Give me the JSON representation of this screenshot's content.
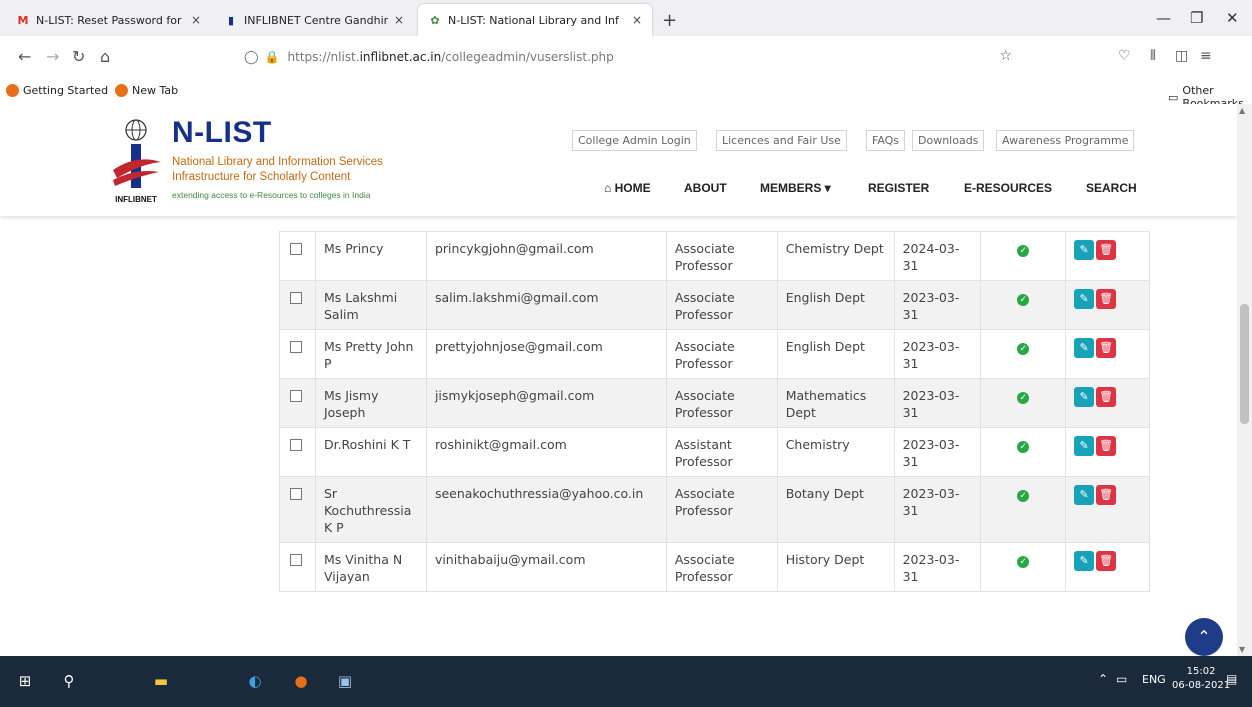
{
  "browser": {
    "tabs": [
      {
        "title": "N-LIST: Reset Password for Sr. M",
        "icon": "gmail-icon"
      },
      {
        "title": "INFLIBNET Centre Gandhinagar",
        "icon": "inflibnet-icon"
      },
      {
        "title": "N-LIST: National Library and Inf",
        "icon": "nlist-icon",
        "active": true
      }
    ],
    "url_prefix": "https://nlist.",
    "url_domain": "inflibnet.ac.in",
    "url_suffix": "/collegeadmin/vuserslist.php",
    "bookmarks": [
      "Getting Started",
      "New Tab"
    ],
    "other_bookmarks": "Other Bookmarks"
  },
  "site": {
    "logo_text": "INFLIBNET",
    "brand": "N-LIST",
    "line1": "National Library and Information Services",
    "line2": "Infrastructure for Scholarly Content",
    "tagline": "extending access to e-Resources to colleges in India",
    "top_links": [
      "College Admin Login",
      "Licences and Fair Use",
      "FAQs",
      "Downloads",
      "Awareness Programme"
    ],
    "nav": {
      "home": "HOME",
      "about": "ABOUT",
      "members": "MEMBERS",
      "register": "REGISTER",
      "eresources": "E-RESOURCES",
      "search": "SEARCH"
    }
  },
  "users": [
    {
      "name": "Ms Princy",
      "email": "princykgjohn@gmail.com",
      "designation": "Associate Professor",
      "department": "Chemistry Dept",
      "expiry": "2024-03-31"
    },
    {
      "name": "Ms Lakshmi Salim",
      "email": "salim.lakshmi@gmail.com",
      "designation": "Associate Professor",
      "department": "English Dept",
      "expiry": "2023-03-31"
    },
    {
      "name": "Ms Pretty John P",
      "email": "prettyjohnjose@gmail.com",
      "designation": "Associate Professor",
      "department": "English Dept",
      "expiry": "2023-03-31"
    },
    {
      "name": "Ms Jismy Joseph",
      "email": "jismykjoseph@gmail.com",
      "designation": "Associate Professor",
      "department": "Mathematics Dept",
      "expiry": "2023-03-31"
    },
    {
      "name": "Dr.Roshini K T",
      "email": "roshinikt@gmail.com",
      "designation": "Assistant Professor",
      "department": "Chemistry",
      "expiry": "2023-03-31"
    },
    {
      "name": "Sr Kochuthressia K P",
      "email": "seenakochuthressia@yahoo.co.in",
      "designation": "Associate Professor",
      "department": "Botany Dept",
      "expiry": "2023-03-31"
    },
    {
      "name": "Ms Vinitha N Vijayan",
      "email": "vinithabaiju@ymail.com",
      "designation": "Associate Professor",
      "department": "History Dept",
      "expiry": "2023-03-31"
    }
  ],
  "taskbar": {
    "lang": "ENG",
    "time": "15:02",
    "date": "06-08-2021"
  },
  "colors": {
    "brand_blue": "#16308a",
    "brand_orange": "#c16a14",
    "status_green": "#28a745",
    "edit_teal": "#17a2b8",
    "delete_red": "#dc3545"
  }
}
